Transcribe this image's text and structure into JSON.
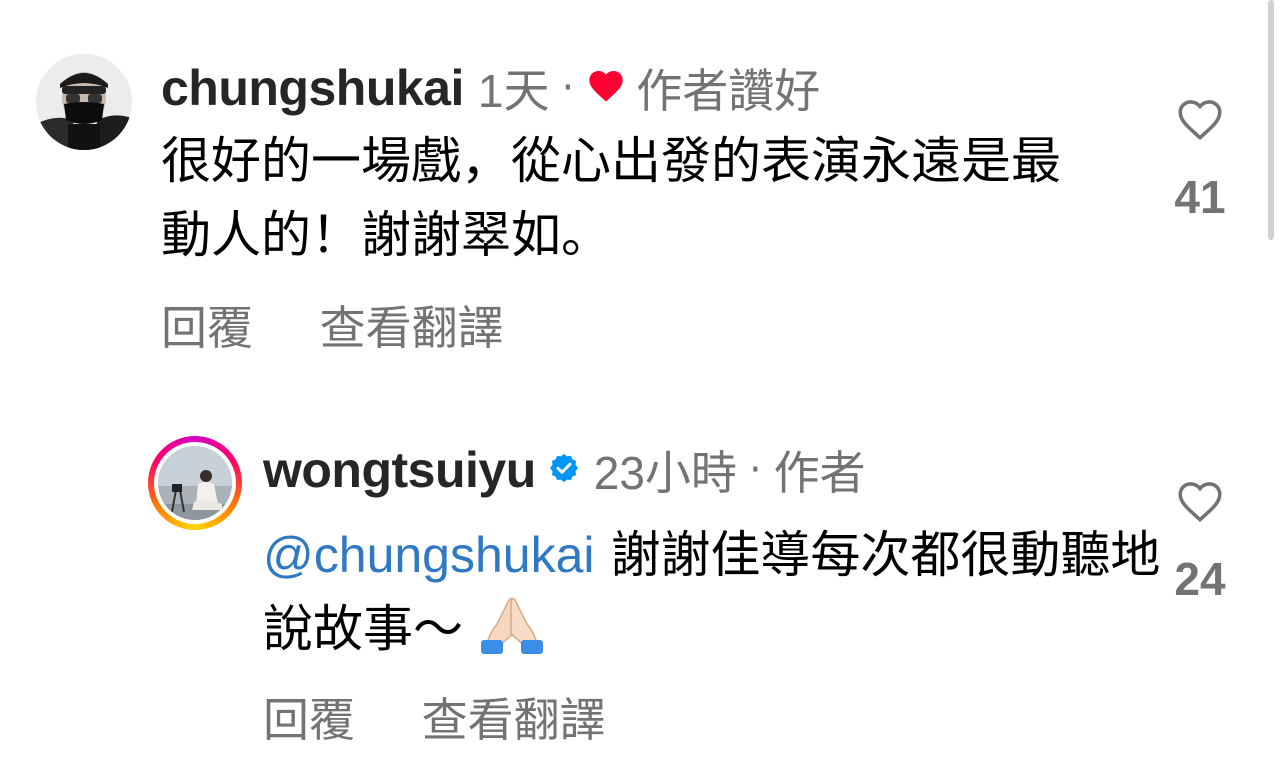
{
  "comments": [
    {
      "username": "chungshukai",
      "time": "1天",
      "separator": "·",
      "author_liked_label": "作者讚好",
      "text": "很好的一場戲，從心出發的表演永遠是最動人的！謝謝翠如。",
      "reply_label": "回覆",
      "translate_label": "查看翻譯",
      "like_count": "41",
      "icons": {
        "avatar": "avatar",
        "author_heart": "heart-filled-icon",
        "like": "heart-outline-icon"
      }
    },
    {
      "username": "wongtsuiyu",
      "verified": true,
      "time": "23小時",
      "separator": "·",
      "author_label": "作者",
      "mention": "@chungshukai",
      "text": "謝謝佳導每次都很動聽地說故事～",
      "emoji": "🙏🏻",
      "reply_label": "回覆",
      "translate_label": "查看翻譯",
      "like_count": "24",
      "icons": {
        "avatar": "story-ring-avatar",
        "verified": "verified-badge-icon",
        "like": "heart-outline-icon"
      }
    }
  ],
  "colors": {
    "text": "#000000",
    "username": "#262626",
    "meta": "#737373",
    "mention": "#2f78c4",
    "heart": "#ff0033",
    "verified": "#0095f6"
  }
}
